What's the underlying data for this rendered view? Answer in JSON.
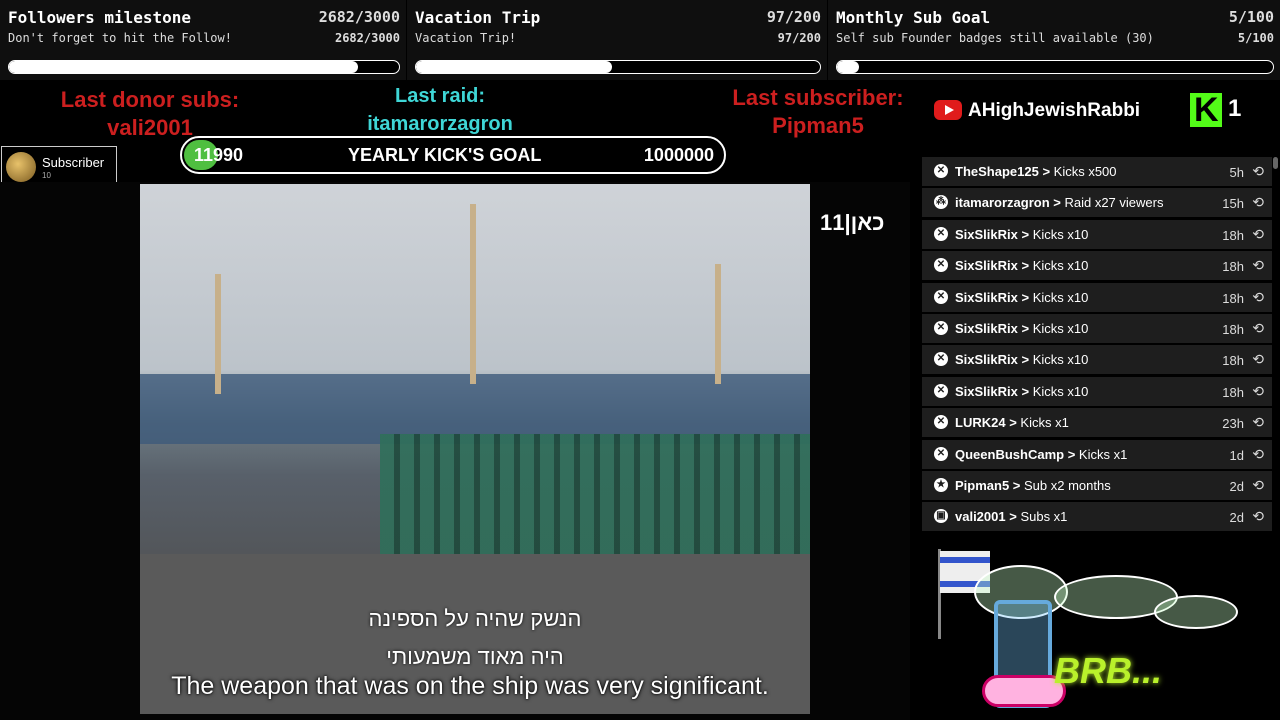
{
  "goals": [
    {
      "title": "Followers milestone",
      "count": "2682/3000",
      "subtitle": "Don't forget to hit the Follow!",
      "count2": "2682/3000",
      "progress": 0.894
    },
    {
      "title": "Vacation Trip",
      "count": "97/200",
      "subtitle": "Vacation Trip!",
      "count2": "97/200",
      "progress": 0.485
    },
    {
      "title": "Monthly Sub Goal",
      "count": "5/100",
      "subtitle": "Self sub Founder badges still available (30)",
      "count2": "5/100",
      "progress": 0.05
    }
  ],
  "stats": {
    "donor_label": "Last donor subs:",
    "donor_name": "vali2001",
    "raid_label": "Last raid:",
    "raid_name": "itamarorzagron",
    "subscriber_label": "Last subscriber:",
    "subscriber_name": "Pipman5"
  },
  "kick_goal": {
    "current": "11990",
    "label": "YEARLY KICK'S GOAL",
    "target": "1000000",
    "progress": 0.012
  },
  "subchip": {
    "label": "Subscriber",
    "count": "10"
  },
  "channel": {
    "name": "AHighJewishRabbi",
    "kick_count": "1"
  },
  "video": {
    "channel_logo": "כאן|11",
    "subtitle_he_1": "הנשק שהיה על הספינה",
    "subtitle_he_2": "היה מאוד משמעותי",
    "subtitle_en": "The weapon that was on the ship was very significant."
  },
  "events": [
    {
      "icon": "kick-icon",
      "user": "TheShape125",
      "desc": "Kicks x500",
      "time": "5h"
    },
    {
      "icon": "raid-icon",
      "user": "itamarorzagron",
      "desc": "Raid x27 viewers",
      "time": "15h"
    },
    {
      "icon": "kick-icon",
      "user": "SixSlikRix",
      "desc": "Kicks x10",
      "time": "18h"
    },
    {
      "icon": "kick-icon",
      "user": "SixSlikRix",
      "desc": "Kicks x10",
      "time": "18h"
    },
    {
      "icon": "kick-icon",
      "user": "SixSlikRix",
      "desc": "Kicks x10",
      "time": "18h"
    },
    {
      "icon": "kick-icon",
      "user": "SixSlikRix",
      "desc": "Kicks x10",
      "time": "18h"
    },
    {
      "icon": "kick-icon",
      "user": "SixSlikRix",
      "desc": "Kicks x10",
      "time": "18h"
    },
    {
      "icon": "kick-icon",
      "user": "SixSlikRix",
      "desc": "Kicks x10",
      "time": "18h"
    },
    {
      "icon": "kick-icon",
      "user": "LURK24",
      "desc": "Kicks x1",
      "time": "23h"
    },
    {
      "icon": "kick-icon",
      "user": "QueenBushCamp",
      "desc": "Kicks x1",
      "time": "1d"
    },
    {
      "icon": "star-icon",
      "user": "Pipman5",
      "desc": "Sub x2 months",
      "time": "2d"
    },
    {
      "icon": "gift-icon",
      "user": "vali2001",
      "desc": "Subs x1",
      "time": "2d"
    }
  ],
  "brb": {
    "text": "BRB..."
  }
}
